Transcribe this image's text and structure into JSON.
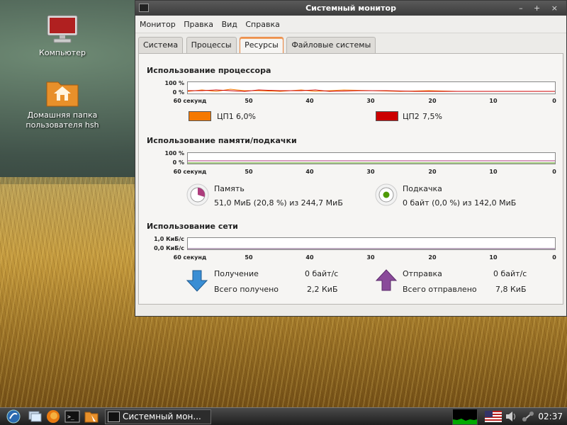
{
  "desktop": {
    "icons": [
      {
        "label": "Компьютер"
      },
      {
        "label": "Домашняя папка пользователя hsh"
      }
    ]
  },
  "window": {
    "title": "Системный монитор",
    "controls": "– + ×",
    "menu": [
      "Монитор",
      "Правка",
      "Вид",
      "Справка"
    ],
    "tabs": [
      "Система",
      "Процессы",
      "Ресурсы",
      "Файловые системы"
    ],
    "active_tab": "Ресурсы"
  },
  "cpu": {
    "title": "Использование процессора",
    "y_labels": [
      "100 %",
      "0 %"
    ],
    "x_labels": [
      "60 секунд",
      "50",
      "40",
      "30",
      "20",
      "10",
      "0"
    ],
    "cpu1": {
      "label": "ЦП1",
      "value": "6,0%",
      "color": "#f57900"
    },
    "cpu2": {
      "label": "ЦП2",
      "value": "7,5%",
      "color": "#cc0000"
    }
  },
  "memory": {
    "title": "Использование памяти/подкачки",
    "y_labels": [
      "100 %",
      "0 %"
    ],
    "x_labels": [
      "60 секунд",
      "50",
      "40",
      "30",
      "20",
      "10",
      "0"
    ],
    "mem_label": "Память",
    "mem_value": "51,0 МиБ (20,8 %) из 244,7 МиБ",
    "swap_label": "Подкачка",
    "swap_value": "0 байт (0,0 %) из 142,0 МиБ",
    "mem_color": "#ad3c7c",
    "swap_color": "#4e9a06"
  },
  "network": {
    "title": "Использование сети",
    "y_labels": [
      "1,0 КиБ/с",
      "0,0 КиБ/с"
    ],
    "x_labels": [
      "60 секунд",
      "50",
      "40",
      "30",
      "20",
      "10",
      "0"
    ],
    "recv_label": "Получение",
    "recv_rate": "0 байт/с",
    "recv_total_label": "Всего получено",
    "recv_total": "2,2 КиБ",
    "send_label": "Отправка",
    "send_rate": "0 байт/с",
    "send_total_label": "Всего отправлено",
    "send_total": "7,8 КиБ",
    "recv_color": "#3465a4",
    "send_color": "#75507b"
  },
  "taskbar": {
    "task_label": "Системный мон...",
    "clock": "02:37"
  }
}
